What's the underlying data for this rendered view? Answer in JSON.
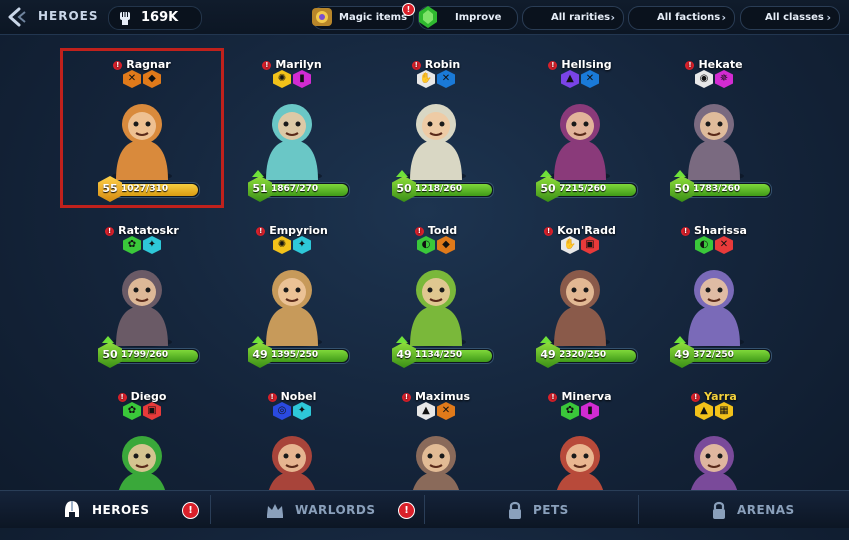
{
  "topbar": {
    "title": "HEROES",
    "power": "169K",
    "magic_items": "Magic items",
    "improve": "Improve",
    "rarities": "All rarities",
    "factions": "All factions",
    "classes": "All classes"
  },
  "heroes": [
    {
      "name": "Ragnar",
      "level": "55",
      "progress": "1027/310",
      "fill": 1.0,
      "gold": true,
      "badges": [
        {
          "bg": "#e07a1a",
          "icon": "✕"
        },
        {
          "bg": "#e07a1a",
          "icon": "◆"
        }
      ],
      "color": "#d98a3c"
    },
    {
      "name": "Marilyn",
      "level": "51",
      "progress": "1867/270",
      "fill": 1.0,
      "badges": [
        {
          "bg": "#f2c21a",
          "icon": "✺"
        },
        {
          "bg": "#d22bd2",
          "icon": "▮"
        }
      ],
      "color": "#6ac7c6"
    },
    {
      "name": "Robin",
      "level": "50",
      "progress": "1218/260",
      "fill": 1.0,
      "badges": [
        {
          "bg": "#e8e8e8",
          "icon": "✋"
        },
        {
          "bg": "#1a7ad8",
          "icon": "✕"
        }
      ],
      "color": "#d9d7c4"
    },
    {
      "name": "Hellsing",
      "level": "50",
      "progress": "7215/260",
      "fill": 1.0,
      "badges": [
        {
          "bg": "#7a44e6",
          "icon": "▲"
        },
        {
          "bg": "#1a7ad8",
          "icon": "✕"
        }
      ],
      "color": "#8a3a7a"
    },
    {
      "name": "Hekate",
      "level": "50",
      "progress": "1783/260",
      "fill": 1.0,
      "badges": [
        {
          "bg": "#e8e8e8",
          "icon": "◉"
        },
        {
          "bg": "#d22bd2",
          "icon": "✵"
        }
      ],
      "color": "#7a6a80"
    },
    {
      "name": "Ratatoskr",
      "level": "50",
      "progress": "1799/260",
      "fill": 1.0,
      "badges": [
        {
          "bg": "#3ac83a",
          "icon": "✿"
        },
        {
          "bg": "#2ec8d8",
          "icon": "✦"
        }
      ],
      "color": "#6a5a66"
    },
    {
      "name": "Empyrion",
      "level": "49",
      "progress": "1395/250",
      "fill": 1.0,
      "badges": [
        {
          "bg": "#f2c21a",
          "icon": "✺"
        },
        {
          "bg": "#2ec8d8",
          "icon": "✦"
        }
      ],
      "color": "#c79a5a"
    },
    {
      "name": "Todd",
      "level": "49",
      "progress": "1134/250",
      "fill": 1.0,
      "badges": [
        {
          "bg": "#3ac83a",
          "icon": "◐"
        },
        {
          "bg": "#e07a1a",
          "icon": "◆"
        }
      ],
      "color": "#7ab83a"
    },
    {
      "name": "Kon'Radd",
      "level": "49",
      "progress": "2320/250",
      "fill": 1.0,
      "badges": [
        {
          "bg": "#e8e8e8",
          "icon": "✋"
        },
        {
          "bg": "#e83a3a",
          "icon": "▣"
        }
      ],
      "color": "#8a5a4a"
    },
    {
      "name": "Sharissa",
      "level": "49",
      "progress": "372/250",
      "fill": 1.0,
      "badges": [
        {
          "bg": "#3ac83a",
          "icon": "◐"
        },
        {
          "bg": "#e83a3a",
          "icon": "✕"
        }
      ],
      "color": "#7a6ab8"
    },
    {
      "name": "Diego",
      "level": "",
      "progress": "",
      "fill": 0,
      "badges": [
        {
          "bg": "#3ac83a",
          "icon": "✿"
        },
        {
          "bg": "#e83a3a",
          "icon": "▣"
        }
      ],
      "color": "#3aa83a"
    },
    {
      "name": "Nobel",
      "level": "",
      "progress": "",
      "fill": 0,
      "badges": [
        {
          "bg": "#2a4ae0",
          "icon": "◎"
        },
        {
          "bg": "#2ec8d8",
          "icon": "✦"
        }
      ],
      "color": "#a8443a"
    },
    {
      "name": "Maximus",
      "level": "",
      "progress": "",
      "fill": 0,
      "badges": [
        {
          "bg": "#e8e8e8",
          "icon": "▲"
        },
        {
          "bg": "#e07a1a",
          "icon": "✕"
        }
      ],
      "color": "#8a6a5a"
    },
    {
      "name": "Minerva",
      "level": "",
      "progress": "",
      "fill": 0,
      "badges": [
        {
          "bg": "#3ac83a",
          "icon": "✿"
        },
        {
          "bg": "#d22bd2",
          "icon": "▮"
        }
      ],
      "color": "#b84a3a"
    },
    {
      "name": "Yarra",
      "level": "",
      "progress": "",
      "fill": 0,
      "gold_name": true,
      "badges": [
        {
          "bg": "#f2c21a",
          "icon": "▲"
        },
        {
          "bg": "#f2c21a",
          "icon": "▦"
        }
      ],
      "color": "#7a4a9a"
    }
  ],
  "nav": {
    "heroes": "HEROES",
    "warlords": "WARLORDS",
    "pets": "PETS",
    "arenas": "ARENAS"
  }
}
